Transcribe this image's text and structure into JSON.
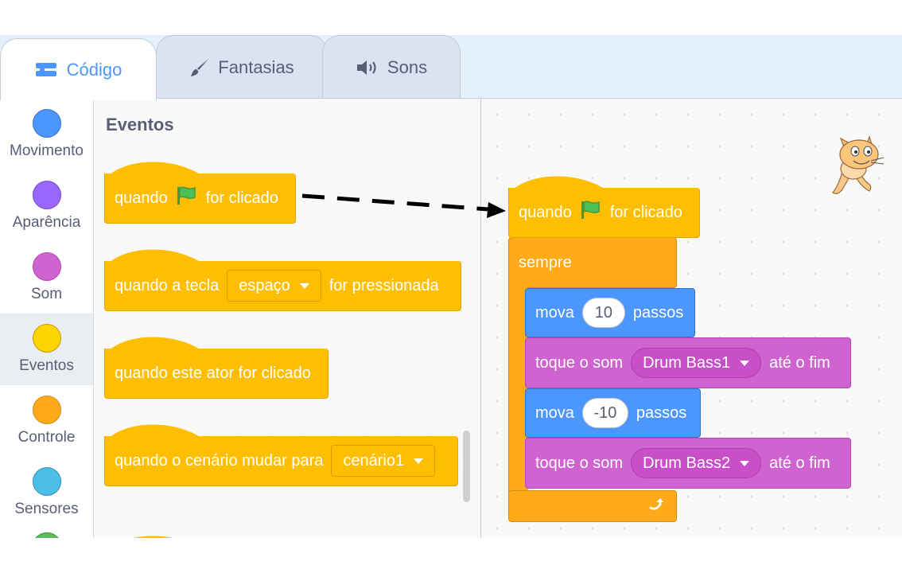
{
  "tabs": [
    {
      "label": "Código",
      "icon": "code-blocks-icon",
      "active": true
    },
    {
      "label": "Fantasias",
      "icon": "paintbrush-icon",
      "active": false
    },
    {
      "label": "Sons",
      "icon": "speaker-icon",
      "active": false
    }
  ],
  "categories": [
    {
      "label": "Movimento",
      "color": "#4c97ff",
      "border": "#3373cc"
    },
    {
      "label": "Aparência",
      "color": "#9966ff",
      "border": "#774dcb"
    },
    {
      "label": "Som",
      "color": "#cf63cf",
      "border": "#bd42bd"
    },
    {
      "label": "Eventos",
      "color": "#ffd500",
      "border": "#cc9900",
      "selected": true
    },
    {
      "label": "Controle",
      "color": "#ffab19",
      "border": "#cf8b17"
    },
    {
      "label": "Sensores",
      "color": "#4cbfe6",
      "border": "#2e8eb8"
    }
  ],
  "palette": {
    "title": "Eventos",
    "blocks": {
      "flag_clicked": {
        "pre": "quando",
        "post": "for clicado"
      },
      "key_pressed": {
        "pre": "quando a tecla",
        "dropdown": "espaço",
        "post": "for pressionada"
      },
      "sprite_clicked": {
        "text": "quando este ator for clicado"
      },
      "backdrop_switch": {
        "pre": "quando o cenário mudar para",
        "dropdown": "cenário1"
      }
    }
  },
  "script": {
    "hat": {
      "pre": "quando",
      "post": "for clicado"
    },
    "forever": {
      "label": "sempre"
    },
    "move1": {
      "pre": "mova",
      "value": "10",
      "post": "passos"
    },
    "sound1": {
      "pre": "toque o som",
      "dropdown": "Drum Bass1",
      "post": "até o fim"
    },
    "move2": {
      "pre": "mova",
      "value": "-10",
      "post": "passos"
    },
    "sound2": {
      "pre": "toque o som",
      "dropdown": "Drum Bass2",
      "post": "até o fim"
    }
  },
  "colors": {
    "events": "#ffbf00",
    "control": "#ffab19",
    "motion": "#4c97ff",
    "sound": "#cf63cf",
    "accent": "#4c97ff"
  }
}
